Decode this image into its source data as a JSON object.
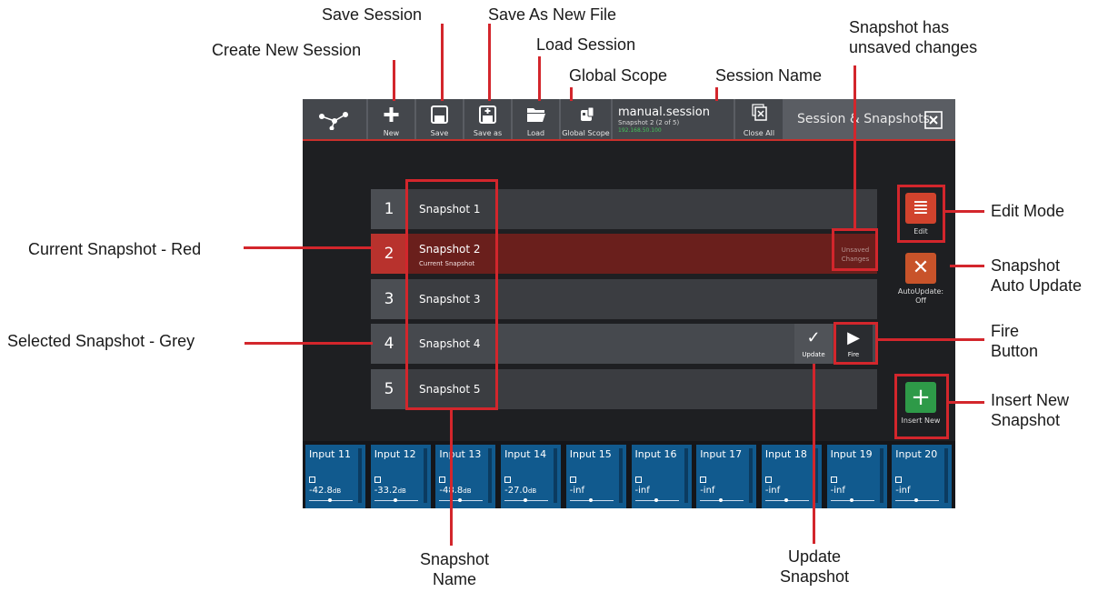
{
  "annotations": {
    "create_new_session": "Create New Session",
    "save_session": "Save Session",
    "save_as_new_file": "Save As New File",
    "load_session": "Load Session",
    "global_scope": "Global Scope",
    "session_name": "Session Name",
    "snapshot_unsaved_1": "Snapshot has",
    "snapshot_unsaved_2": "unsaved changes",
    "edit_mode": "Edit Mode",
    "current_snapshot": "Current Snapshot - Red",
    "snapshot_auto_update_1": "Snapshot",
    "snapshot_auto_update_2": "Auto Update",
    "selected_snapshot": "Selected Snapshot - Grey",
    "fire_button_1": "Fire",
    "fire_button_2": "Button",
    "insert_new_1": "Insert New",
    "insert_new_2": "Snapshot",
    "snapshot_name_1": "Snapshot",
    "snapshot_name_2": "Name",
    "update_snapshot_1": "Update",
    "update_snapshot_2": "Snapshot"
  },
  "toolbar": {
    "new": "New",
    "save": "Save",
    "save_as": "Save as",
    "load": "Load",
    "global_scope": "Global Scope",
    "close_all": "Close All",
    "icons": [
      "share-nodes-icon",
      "plus-icon",
      "floppy-disk-icon",
      "floppy-disk-plus-icon",
      "folder-open-icon",
      "global-scope-icon",
      "close-all-icon",
      "close-icon"
    ]
  },
  "session": {
    "name": "manual.session",
    "snapshot_info": "Snapshot 2 (2 of 5)",
    "ip": "192.168.50.100"
  },
  "panel_title": "Session & Snapshots",
  "snapshots": [
    {
      "num": "1",
      "name": "Snapshot 1"
    },
    {
      "num": "2",
      "name": "Snapshot 2",
      "sub": "Current Snapshot",
      "unsaved": "Unsaved Changes"
    },
    {
      "num": "3",
      "name": "Snapshot 3"
    },
    {
      "num": "4",
      "name": "Snapshot 4",
      "update": "Update",
      "fire": "Fire"
    },
    {
      "num": "5",
      "name": "Snapshot 5"
    }
  ],
  "side": {
    "edit": "Edit",
    "autoupdate": "AutoUpdate: Off",
    "insert_new": "Insert New"
  },
  "channels": [
    {
      "name": "Input 11",
      "level": "-42.8",
      "unit": "dB"
    },
    {
      "name": "Input 12",
      "level": "-33.2",
      "unit": "dB"
    },
    {
      "name": "Input 13",
      "level": "-48.8",
      "unit": "dB"
    },
    {
      "name": "Input 14",
      "level": "-27.0",
      "unit": "dB"
    },
    {
      "name": "Input 15",
      "level": "-inf",
      "unit": ""
    },
    {
      "name": "Input 16",
      "level": "-inf",
      "unit": ""
    },
    {
      "name": "Input 17",
      "level": "-inf",
      "unit": ""
    },
    {
      "name": "Input 18",
      "level": "-inf",
      "unit": ""
    },
    {
      "name": "Input 19",
      "level": "-inf",
      "unit": ""
    },
    {
      "name": "Input 20",
      "level": "-inf",
      "unit": ""
    }
  ],
  "colors": {
    "accent_red": "#d3262c",
    "current_red": "#b8322d",
    "edit_red": "#d1432d",
    "autoupdate_orange": "#c8532a",
    "insert_green": "#2e9a48",
    "channel_blue": "#115a8e"
  }
}
